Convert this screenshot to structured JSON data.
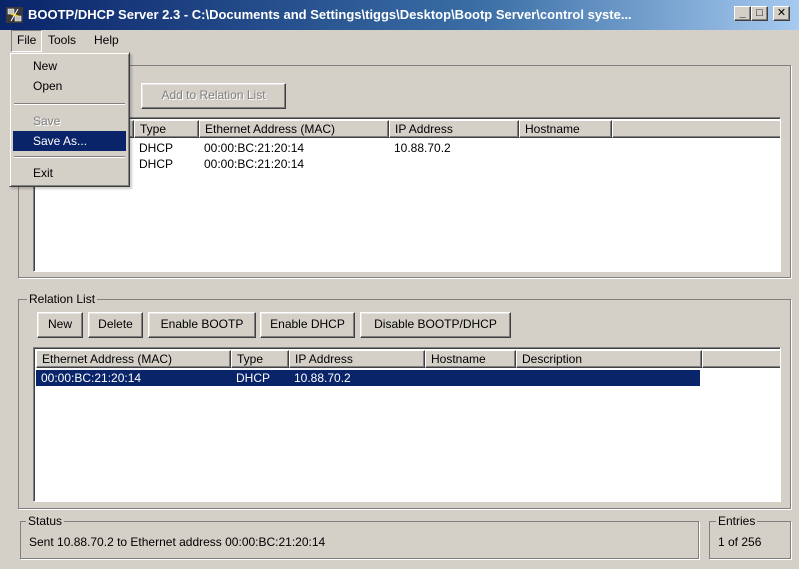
{
  "window": {
    "title": "BOOTP/DHCP Server 2.3 - C:\\Documents and Settings\\tiggs\\Desktop\\Bootp Server\\control syste...",
    "minimize_glyph": "_",
    "maximize_glyph": "□",
    "close_glyph": "✕",
    "icon": "app-network-icon"
  },
  "menubar": {
    "file": "File",
    "tools": "Tools",
    "help": "Help"
  },
  "file_menu": {
    "new": "New",
    "open": "Open",
    "save": "Save",
    "save_as": "Save As...",
    "exit": "Exit"
  },
  "request_history": {
    "add_button": "Add to Relation List",
    "columns": [
      "Type",
      "Ethernet Address (MAC)",
      "IP Address",
      "Hostname"
    ],
    "rows": [
      {
        "type": "DHCP",
        "mac": "00:00:BC:21:20:14",
        "ip": "10.88.70.2",
        "hostname": ""
      },
      {
        "type": "DHCP",
        "mac": "00:00:BC:21:20:14",
        "ip": "",
        "hostname": ""
      }
    ]
  },
  "relation_list": {
    "legend": "Relation List",
    "buttons": {
      "new": "New",
      "delete": "Delete",
      "enable_bootp": "Enable BOOTP",
      "enable_dhcp": "Enable DHCP",
      "disable": "Disable BOOTP/DHCP"
    },
    "columns": [
      "Ethernet Address (MAC)",
      "Type",
      "IP Address",
      "Hostname",
      "Description"
    ],
    "rows": [
      {
        "mac": "00:00:BC:21:20:14",
        "type": "DHCP",
        "ip": "10.88.70.2",
        "hostname": "",
        "description": ""
      }
    ]
  },
  "status": {
    "legend": "Status",
    "text": "Sent 10.88.70.2 to Ethernet address 00:00:BC:21:20:14"
  },
  "entries": {
    "legend": "Entries",
    "text": "1 of 256"
  },
  "colors": {
    "title_gradient_start": "#0a246a",
    "selection": "#0a246a",
    "face": "#d4d0c8"
  }
}
